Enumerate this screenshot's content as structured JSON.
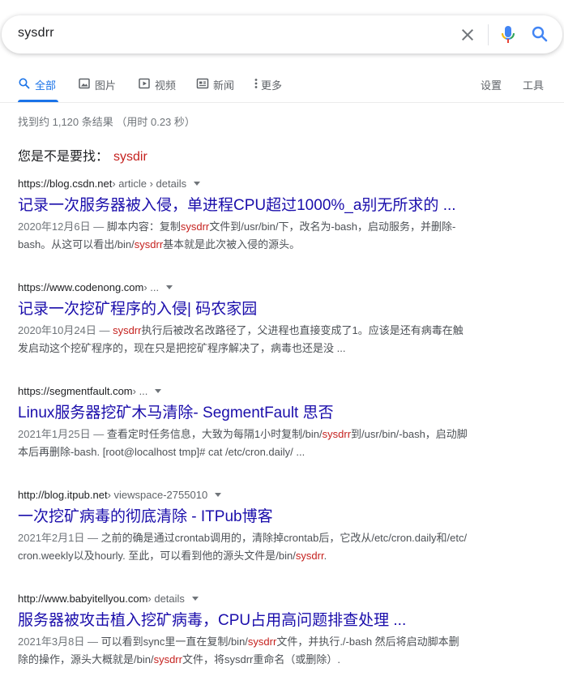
{
  "search": {
    "query": "sysdrr",
    "icons": {
      "clear": "close-icon",
      "voice": "mic-icon",
      "submit": "search-icon"
    }
  },
  "tabs": [
    {
      "label": "全部",
      "icon": "search-icon",
      "active": true
    },
    {
      "label": "图片",
      "icon": "image-icon",
      "active": false
    },
    {
      "label": "视频",
      "icon": "play-icon",
      "active": false
    },
    {
      "label": "新闻",
      "icon": "news-icon",
      "active": false
    },
    {
      "label": "更多",
      "icon": "more-vert-icon",
      "active": false
    }
  ],
  "tools": {
    "settings": "设置",
    "tools": "工具"
  },
  "stats": "找到约 1,120 条结果 （用时 0.23 秒）",
  "did_you_mean": {
    "label": "您是不是要找：",
    "suggestion": "sysdir"
  },
  "results": [
    {
      "site": "https://blog.csdn.net",
      "path": " › article › details",
      "title": "记录一次服务器被入侵，单进程CPU超过1000%_a别无所求的 ...",
      "date": "2020年12月6日 — ",
      "lines": [
        [
          "脚本内容：复制",
          "sysdrr",
          "文件到/usr/bin/下，改名为-bash，启动服务，并删除-"
        ],
        [
          "bash。从这可以看出/bin/",
          "sysdrr",
          "基本就是此次被入侵的源头。"
        ]
      ]
    },
    {
      "site": "https://www.codenong.com",
      "path": " › ...",
      "title": "记录一次挖矿程序的入侵| 码农家园",
      "date": "2020年10月24日 — ",
      "lines": [
        [
          "",
          "sysdrr",
          "执行后被改名改路径了，父进程也直接变成了1。应该是还有病毒在触"
        ],
        [
          "发启动这个挖矿程序的，现在只是把挖矿程序解决了，病毒也还是没 ...",
          "",
          ""
        ]
      ]
    },
    {
      "site": "https://segmentfault.com",
      "path": " › ...",
      "title": "Linux服务器挖矿木马清除- SegmentFault 思否",
      "date": "2021年1月25日 — ",
      "lines": [
        [
          "查看定时任务信息，大致为每隔1小时复制/bin/",
          "sysdrr",
          "到/usr/bin/-bash，启动脚"
        ],
        [
          "本后再删除-bash. [root@localhost tmp]# cat /etc/cron.daily/ ...",
          "",
          ""
        ]
      ]
    },
    {
      "site": "http://blog.itpub.net",
      "path": " › viewspace-2755010",
      "title": "一次挖矿病毒的彻底清除 - ITPub博客",
      "date": "2021年2月1日 — ",
      "lines": [
        [
          "之前的确是通过crontab调用的，清除掉crontab后，它改从/etc/cron.daily和/etc/",
          "",
          ""
        ],
        [
          "cron.weekly以及hourly. 至此，可以看到他的源头文件是/bin/",
          "sysdrr",
          "."
        ]
      ]
    },
    {
      "site": "http://www.babyitellyou.com",
      "path": " › details",
      "title": "服务器被攻击植入挖矿病毒，CPU占用高问题排查处理 ...",
      "date": "2021年3月8日 — ",
      "lines": [
        [
          "可以看到sync里一直在复制/bin/",
          "sysdrr",
          "文件，并执行./-bash 然后将启动脚本删"
        ],
        [
          "除的操作，源头大概就是/bin/",
          "sysdrr",
          "文件，将sysdrr重命名（或删除）."
        ]
      ]
    }
  ],
  "colors": {
    "link": "#1a0dab",
    "highlight": "#c5221f",
    "active_tab": "#1a73e8",
    "mic_blue": "#4285f4",
    "mic_red": "#ea4335",
    "mic_yellow": "#fbbc04",
    "mic_green": "#34a853"
  }
}
